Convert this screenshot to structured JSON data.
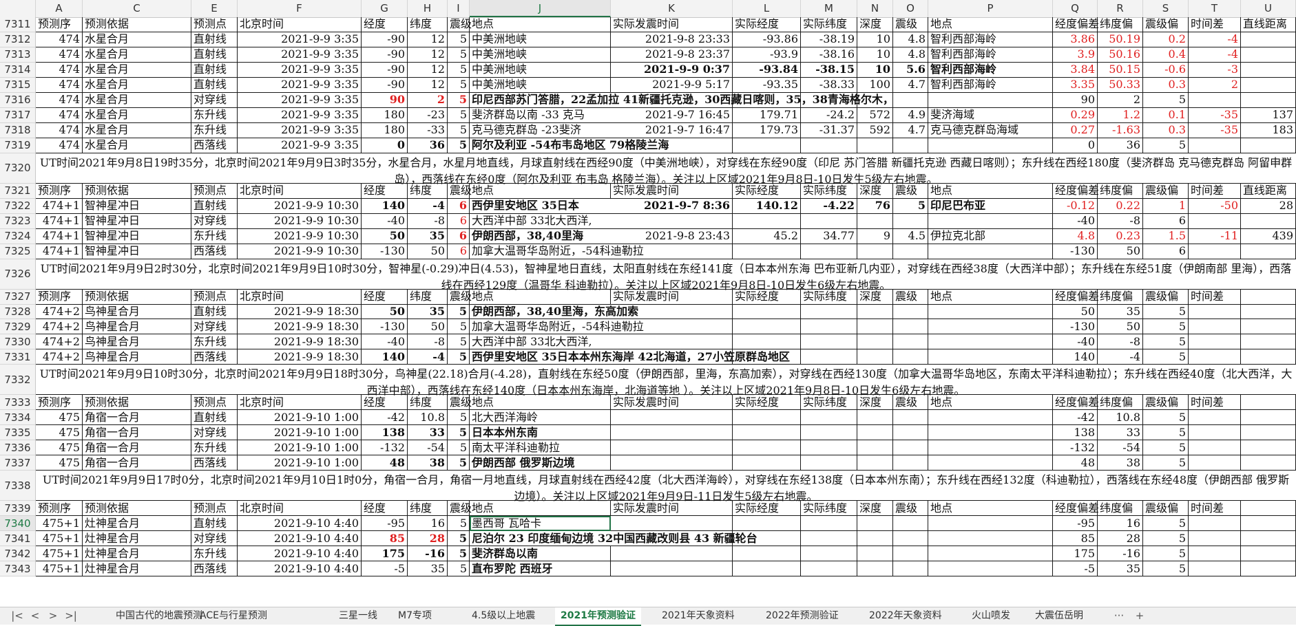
{
  "columns": [
    "A",
    "C",
    "E",
    "F",
    "G",
    "H",
    "I",
    "J",
    "K",
    "L",
    "M",
    "N",
    "O",
    "P",
    "Q",
    "R",
    "S",
    "T",
    "U"
  ],
  "selected_column": "J",
  "selected_row": "7340",
  "rows": [
    {
      "n": "7311",
      "type": "header",
      "cells": [
        "预测序",
        "预测依据",
        "预测点",
        "北京时间",
        "经度",
        "纬度",
        "震级",
        "地点",
        "实际发震时间",
        "实际经度",
        "实际纬度",
        "深度",
        "震级",
        "地点",
        "经度偏差",
        "纬度偏",
        "震级偏",
        "时间差",
        "直线距离"
      ]
    },
    {
      "n": "7312",
      "type": "data",
      "cells": [
        "474",
        "水星合月",
        "直射线",
        "2021-9-9 3:35",
        "-90",
        "12",
        "5",
        "中美洲地峡",
        "2021-9-8 23:33",
        "-93.86",
        "-38.19",
        "10",
        "4.8",
        "智利西部海岭",
        "3.86",
        "50.19",
        "0.2",
        "-4",
        ""
      ],
      "red": [
        14,
        15,
        16,
        17
      ]
    },
    {
      "n": "7313",
      "type": "data",
      "cells": [
        "474",
        "水星合月",
        "直射线",
        "2021-9-9 3:35",
        "-90",
        "12",
        "5",
        "中美洲地峡",
        "2021-9-8 23:37",
        "-93.9",
        "-38.16",
        "10",
        "4.8",
        "智利西部海岭",
        "3.9",
        "50.16",
        "0.4",
        "-4",
        ""
      ],
      "red": [
        14,
        15,
        16,
        17
      ]
    },
    {
      "n": "7314",
      "type": "data",
      "cells": [
        "474",
        "水星合月",
        "直射线",
        "2021-9-9 3:35",
        "-90",
        "12",
        "5",
        "中美洲地峡",
        "2021-9-9 0:37",
        "-93.84",
        "-38.15",
        "10",
        "5.6",
        "智利西部海岭",
        "3.84",
        "50.15",
        "-0.6",
        "-3",
        ""
      ],
      "red": [
        14,
        15,
        16,
        17
      ],
      "bold": [
        8,
        9,
        10,
        11,
        12,
        13
      ]
    },
    {
      "n": "7315",
      "type": "data",
      "cells": [
        "474",
        "水星合月",
        "直射线",
        "2021-9-9 3:35",
        "-90",
        "12",
        "5",
        "中美洲地峡",
        "2021-9-9 5:17",
        "-93.35",
        "-38.33",
        "100",
        "4.7",
        "智利西部海岭",
        "3.35",
        "50.33",
        "0.3",
        "2",
        ""
      ],
      "red": [
        14,
        15,
        16,
        17
      ]
    },
    {
      "n": "7316",
      "type": "data",
      "cells": [
        "474",
        "水星合月",
        "对穿线",
        "2021-9-9 3:35",
        "90",
        "2",
        "5",
        "印尼西部苏门答腊，22孟加拉 41新疆托克逊，30西藏日喀则，35，38青海格尔木，",
        "",
        "",
        "",
        "",
        "",
        "",
        "90",
        "2",
        "5",
        "",
        ""
      ],
      "red": [
        4,
        5,
        6
      ],
      "bold": [
        4,
        5,
        6,
        7
      ]
    },
    {
      "n": "7317",
      "type": "data",
      "cells": [
        "474",
        "水星合月",
        "东升线",
        "2021-9-9 3:35",
        "180",
        "-23",
        "5",
        "斐济群岛以南 -33 克马",
        "2021-9-7 16:45",
        "179.71",
        "-24.2",
        "572",
        "4.9",
        "斐济海域",
        "0.29",
        "1.2",
        "0.1",
        "-35",
        "137"
      ],
      "red": [
        14,
        15,
        16,
        17
      ]
    },
    {
      "n": "7318",
      "type": "data",
      "cells": [
        "474",
        "水星合月",
        "东升线",
        "2021-9-9 3:35",
        "180",
        "-33",
        "5",
        "克马德克群岛 -23斐济",
        "2021-9-7 16:47",
        "179.73",
        "-31.37",
        "592",
        "4.7",
        "克马德克群岛海域",
        "0.27",
        "-1.63",
        "0.3",
        "-35",
        "183"
      ],
      "red": [
        14,
        15,
        16,
        17
      ]
    },
    {
      "n": "7319",
      "type": "data",
      "cells": [
        "474",
        "水星合月",
        "西落线",
        "2021-9-9 3:35",
        "0",
        "36",
        "5",
        "阿尔及利亚 -54布韦岛地区 79格陵兰海",
        "",
        "",
        "",
        "",
        "",
        "",
        "0",
        "36",
        "5",
        "",
        ""
      ],
      "bold": [
        4,
        5,
        6,
        7
      ]
    },
    {
      "n": "7320",
      "type": "note",
      "text": "UT时间2021年9月8日19时35分，北京时间2021年9月9日3时35分，水星合月，水星月地直线，月球直射线在西经90度（中美洲地峡），对穿线在东经90度（印尼 苏门答腊 新疆托克逊 西藏日喀则）；东升线在西经180度（斐济群岛 克马德克群岛 阿留申群岛），西落线在东经0度（阿尔及利亚 布韦岛 格陵兰海）。关注以上区域2021年9月8日-10日发生5级左右地震。"
    },
    {
      "n": "7321",
      "type": "header",
      "cells": [
        "预测序",
        "预测依据",
        "预测点",
        "北京时间",
        "经度",
        "纬度",
        "震级",
        "地点",
        "实际发震时间",
        "实际经度",
        "实际纬度",
        "深度",
        "震级",
        "地点",
        "经度偏差",
        "纬度偏",
        "震级偏",
        "时间差",
        "直线距离"
      ]
    },
    {
      "n": "7322",
      "type": "data",
      "cells": [
        "474+1",
        "智神星冲日",
        "直射线",
        "2021-9-9 10:30",
        "140",
        "-4",
        "6",
        "西伊里安地区 35日本",
        "2021-9-7 8:36",
        "140.12",
        "-4.22",
        "76",
        "5",
        "印尼巴布亚",
        "-0.12",
        "0.22",
        "1",
        "-50",
        "28"
      ],
      "red": [
        6,
        14,
        15,
        16,
        17
      ],
      "bold": [
        4,
        5,
        6,
        7,
        8,
        9,
        10,
        11,
        12,
        13
      ]
    },
    {
      "n": "7323",
      "type": "data",
      "cells": [
        "474+1",
        "智神星冲日",
        "对穿线",
        "2021-9-9 10:30",
        "-40",
        "-8",
        "6",
        "大西洋中部 33北大西洋,",
        "",
        "",
        "",
        "",
        "",
        "",
        "-40",
        "-8",
        "6",
        "",
        ""
      ],
      "red": [
        6
      ]
    },
    {
      "n": "7324",
      "type": "data",
      "cells": [
        "474+1",
        "智神星冲日",
        "东升线",
        "2021-9-9 10:30",
        "50",
        "35",
        "6",
        "伊朗西部，38,40里海",
        "2021-9-8 23:43",
        "45.2",
        "34.77",
        "9",
        "4.5",
        "伊拉克北部",
        "4.8",
        "0.23",
        "1.5",
        "-11",
        "439"
      ],
      "red": [
        6,
        14,
        15,
        16,
        17
      ],
      "bold": [
        4,
        5,
        6,
        7
      ]
    },
    {
      "n": "7325",
      "type": "data",
      "cells": [
        "474+1",
        "智神星冲日",
        "西落线",
        "2021-9-9 10:30",
        "-130",
        "50",
        "6",
        "加拿大温哥华岛附近，-54科迪勒拉",
        "",
        "",
        "",
        "",
        "",
        "",
        "-130",
        "50",
        "6",
        "",
        ""
      ],
      "red": [
        6
      ]
    },
    {
      "n": "7326",
      "type": "note",
      "text": "UT时间2021年9月9日2时30分，北京时间2021年9月9日10时30分，智神星(-0.29)冲日(4.53)，智神星地日直线，太阳直射线在东经141度（日本本州东海 巴布亚新几内亚），对穿线在西经38度（大西洋中部）；东升线在东经51度（伊朗南部 里海），西落线在西经129度（温哥华 科迪勒拉）。关注以上区域2021年9月8日-10日发生6级左右地震。"
    },
    {
      "n": "7327",
      "type": "header",
      "cells": [
        "预测序",
        "预测依据",
        "预测点",
        "北京时间",
        "经度",
        "纬度",
        "震级",
        "地点",
        "实际发震时间",
        "实际经度",
        "实际纬度",
        "深度",
        "震级",
        "地点",
        "经度偏差",
        "纬度偏",
        "震级偏",
        "时间差",
        ""
      ]
    },
    {
      "n": "7328",
      "type": "data",
      "cells": [
        "474+2",
        "鸟神星合月",
        "直射线",
        "2021-9-9 18:30",
        "50",
        "35",
        "5",
        "伊朗西部，38,40里海，东高加索",
        "",
        "",
        "",
        "",
        "",
        "",
        "50",
        "35",
        "5",
        "",
        ""
      ],
      "bold": [
        4,
        5,
        6,
        7
      ]
    },
    {
      "n": "7329",
      "type": "data",
      "cells": [
        "474+2",
        "鸟神星合月",
        "对穿线",
        "2021-9-9 18:30",
        "-130",
        "50",
        "5",
        "加拿大温哥华岛附近，-54科迪勒拉",
        "",
        "",
        "",
        "",
        "",
        "",
        "-130",
        "50",
        "5",
        "",
        ""
      ]
    },
    {
      "n": "7330",
      "type": "data",
      "cells": [
        "474+2",
        "鸟神星合月",
        "东升线",
        "2021-9-9 18:30",
        "-40",
        "-8",
        "5",
        "大西洋中部 33北大西洋,",
        "",
        "",
        "",
        "",
        "",
        "",
        "-40",
        "-8",
        "5",
        "",
        ""
      ]
    },
    {
      "n": "7331",
      "type": "data",
      "cells": [
        "474+2",
        "鸟神星合月",
        "西落线",
        "2021-9-9 18:30",
        "140",
        "-4",
        "5",
        "西伊里安地区 35日本本州东海岸  42北海道，27小笠原群岛地区",
        "",
        "",
        "",
        "",
        "",
        "",
        "140",
        "-4",
        "5",
        "",
        ""
      ],
      "bold": [
        4,
        5,
        6,
        7
      ]
    },
    {
      "n": "7332",
      "type": "note",
      "text": "UT时间2021年9月9日10时30分，北京时间2021年9月9日18时30分，鸟神星(22.18)合月(-4.28)，直射线在东经50度（伊朗西部，里海，东高加索），对穿线在西经130度（加拿大温哥华岛地区，东南太平洋科迪勒拉）；东升线在西经40度（北大西洋，大西洋中部），西落线在东经140度（日本本州东海岸，北海道等地 ）。关注以上区域2021年9月8日-10日发生6级左右地震。"
    },
    {
      "n": "7333",
      "type": "header",
      "cells": [
        "预测序",
        "预测依据",
        "预测点",
        "北京时间",
        "经度",
        "纬度",
        "震级",
        "地点",
        "实际发震时间",
        "实际经度",
        "实际纬度",
        "深度",
        "震级",
        "地点",
        "经度偏差",
        "纬度偏",
        "震级偏",
        "时间差",
        ""
      ]
    },
    {
      "n": "7334",
      "type": "data",
      "cells": [
        "475",
        "角宿一合月",
        "直射线",
        "2021-9-10 1:00",
        "-42",
        "10.8",
        "5",
        "北大西洋海岭",
        "",
        "",
        "",
        "",
        "",
        "",
        "-42",
        "10.8",
        "5",
        "",
        ""
      ]
    },
    {
      "n": "7335",
      "type": "data",
      "cells": [
        "475",
        "角宿一合月",
        "对穿线",
        "2021-9-10 1:00",
        "138",
        "33",
        "5",
        "日本本州东南",
        "",
        "",
        "",
        "",
        "",
        "",
        "138",
        "33",
        "5",
        "",
        ""
      ],
      "bold": [
        4,
        5,
        6,
        7
      ]
    },
    {
      "n": "7336",
      "type": "data",
      "cells": [
        "475",
        "角宿一合月",
        "东升线",
        "2021-9-10 1:00",
        "-132",
        "-54",
        "5",
        "南太平洋科迪勒拉",
        "",
        "",
        "",
        "",
        "",
        "",
        "-132",
        "-54",
        "5",
        "",
        ""
      ]
    },
    {
      "n": "7337",
      "type": "data",
      "cells": [
        "475",
        "角宿一合月",
        "西落线",
        "2021-9-10 1:00",
        "48",
        "38",
        "5",
        "伊朗西部 俄罗斯边境",
        "",
        "",
        "",
        "",
        "",
        "",
        "48",
        "38",
        "5",
        "",
        ""
      ],
      "bold": [
        4,
        5,
        6,
        7
      ]
    },
    {
      "n": "7338",
      "type": "note",
      "text": "UT时间2021年9月9日17时0分，北京时间2021年9月10日1时0分，角宿一合月，角宿一月地直线，月球直射线在西经42度（北大西洋海岭），对穿线在东经138度（日本本州东南）；东升线在西经132度（科迪勒拉），西落线在东经48度（伊朗西部 俄罗斯边境）。关注以上区域2021年9月9日-11日发生5级左右地震。"
    },
    {
      "n": "7339",
      "type": "header",
      "cells": [
        "预测序",
        "预测依据",
        "预测点",
        "北京时间",
        "经度",
        "纬度",
        "震级",
        "地点",
        "实际发震时间",
        "实际经度",
        "实际纬度",
        "深度",
        "震级",
        "地点",
        "经度偏差",
        "纬度偏",
        "震级偏",
        "时间差",
        ""
      ]
    },
    {
      "n": "7340",
      "type": "data",
      "cells": [
        "475+1",
        "灶神星合月",
        "直射线",
        "2021-9-10 4:40",
        "-95",
        "16",
        "5",
        "墨西哥 瓦哈卡",
        "",
        "",
        "",
        "",
        "",
        "",
        "-95",
        "16",
        "5",
        "",
        ""
      ]
    },
    {
      "n": "7341",
      "type": "data",
      "cells": [
        "475+1",
        "灶神星合月",
        "对穿线",
        "2021-9-10 4:40",
        "85",
        "28",
        "5",
        "尼泊尔 23 印度缅甸边境 32中国西藏改则县 43 新疆轮台",
        "",
        "",
        "",
        "",
        "",
        "",
        "85",
        "28",
        "5",
        "",
        ""
      ],
      "red": [
        4,
        5
      ],
      "bold": [
        4,
        5,
        6,
        7
      ]
    },
    {
      "n": "7342",
      "type": "data",
      "cells": [
        "475+1",
        "灶神星合月",
        "东升线",
        "2021-9-10 4:40",
        "175",
        "-16",
        "5",
        "斐济群岛以南",
        "",
        "",
        "",
        "",
        "",
        "",
        "175",
        "-16",
        "5",
        "",
        ""
      ],
      "bold": [
        4,
        5,
        6,
        7
      ]
    },
    {
      "n": "7343",
      "type": "data",
      "cells": [
        "475+1",
        "灶神星合月",
        "西落线",
        "2021-9-10 4:40",
        "-5",
        "35",
        "5",
        "直布罗陀 西班牙",
        "",
        "",
        "",
        "",
        "",
        "",
        "-5",
        "35",
        "5",
        "",
        ""
      ],
      "bold": [
        7
      ]
    }
  ],
  "tabs": {
    "nav": [
      "|<",
      "<",
      ">",
      ">|"
    ],
    "sheets": [
      "中国古代的地震预测",
      "ACE与行星预测",
      "三星一线",
      "M7专项",
      "4.5级以上地震",
      "2021年预测验证",
      "2021年天象资料",
      "2022年预测验证",
      "2022年天象资料",
      "火山喷发",
      "大震伍岳明"
    ],
    "active": "2021年预测验证",
    "more": "···",
    "add": "+"
  }
}
